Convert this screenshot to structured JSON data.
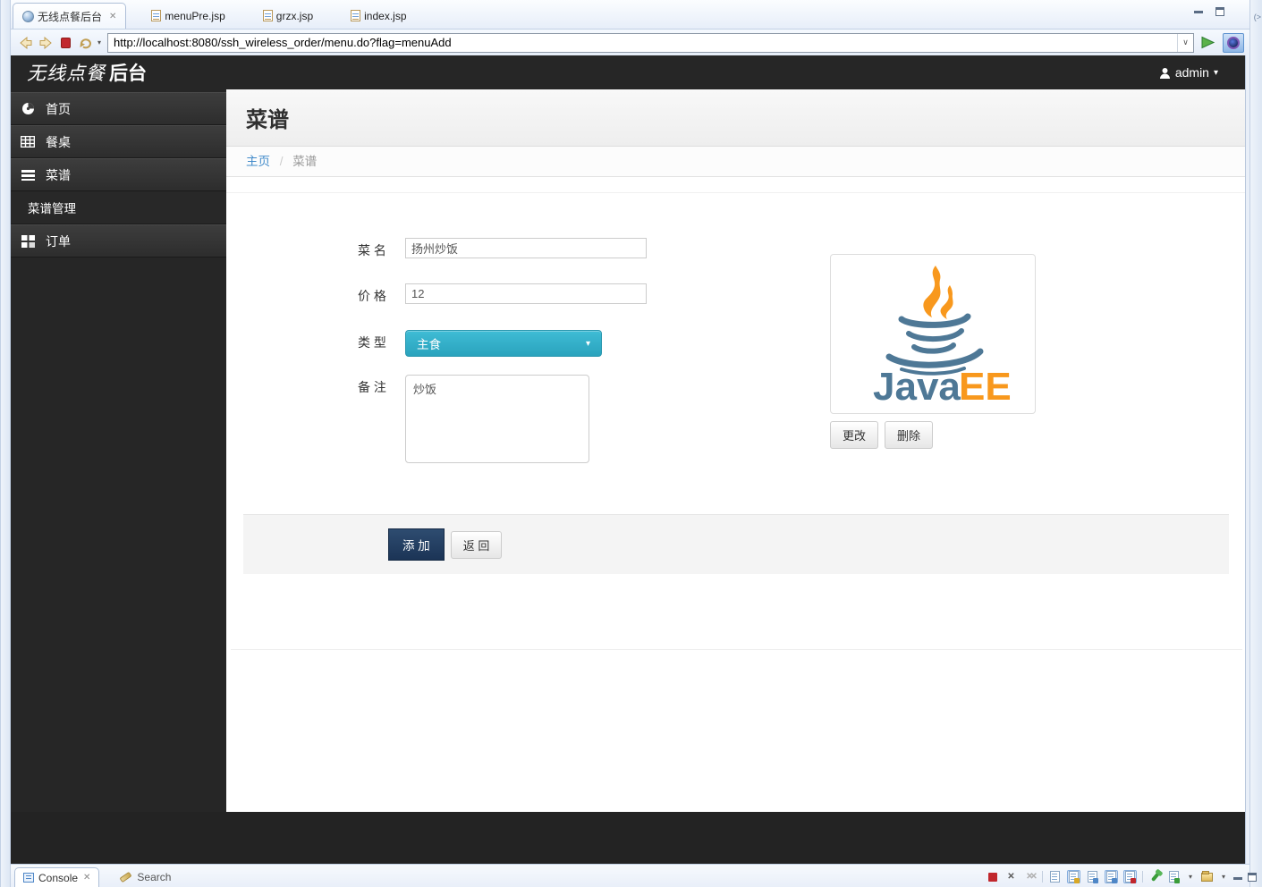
{
  "colors": {
    "accent_cyan": "#35b1ca",
    "primary_navy": "#1f3a5c",
    "link_blue": "#428bca",
    "java_blue": "#4e7896",
    "java_orange": "#f8981d",
    "stop_red": "#c1272d",
    "header_dark": "#262626"
  },
  "window": {
    "collapsed_panel_glyph": "(>"
  },
  "editor": {
    "tabs": [
      {
        "label": "无线点餐后台",
        "icon": "globe-icon",
        "close_glyph": "✕",
        "active": true
      },
      {
        "label": "menuPre.jsp",
        "icon": "jsp-file-icon",
        "active": false
      },
      {
        "label": "grzx.jsp",
        "icon": "jsp-file-icon",
        "active": false
      },
      {
        "label": "index.jsp",
        "icon": "jsp-file-icon",
        "active": false
      }
    ]
  },
  "browser": {
    "url": "http://localhost:8080/ssh_wireless_order/menu.do?flag=menuAdd",
    "nav_dropdown_glyph": "▾",
    "url_dropdown_glyph": "∨"
  },
  "app_header": {
    "brand_script": "无线点餐",
    "brand_bold": "后台",
    "user": {
      "name": "admin",
      "caret_glyph": "▾"
    }
  },
  "sidebar": {
    "items": [
      {
        "label": "首页"
      },
      {
        "label": "餐桌"
      },
      {
        "label": "菜谱"
      },
      {
        "label": "菜谱管理"
      },
      {
        "label": "订单"
      }
    ]
  },
  "page": {
    "title": "菜谱",
    "breadcrumb": {
      "home": "主页",
      "separator": "/",
      "current": "菜谱"
    }
  },
  "form": {
    "fields": {
      "name": {
        "label": "菜 名",
        "value": "扬州炒饭"
      },
      "price": {
        "label": "价 格",
        "value": "12"
      },
      "type": {
        "label": "类 型",
        "value": "主食",
        "caret_glyph": "▾"
      },
      "note": {
        "label": "备 注",
        "value": "炒饭"
      }
    },
    "image": {
      "logo_java": "Java",
      "logo_ee": "EE",
      "update_label": "更改",
      "delete_label": "删除"
    },
    "actions": {
      "submit_label": "添 加",
      "back_label": "返 回"
    }
  },
  "console_panel": {
    "tabs": [
      {
        "label": "Console",
        "close_glyph": "✕",
        "active": true
      },
      {
        "label": "Search",
        "active": false
      }
    ]
  }
}
